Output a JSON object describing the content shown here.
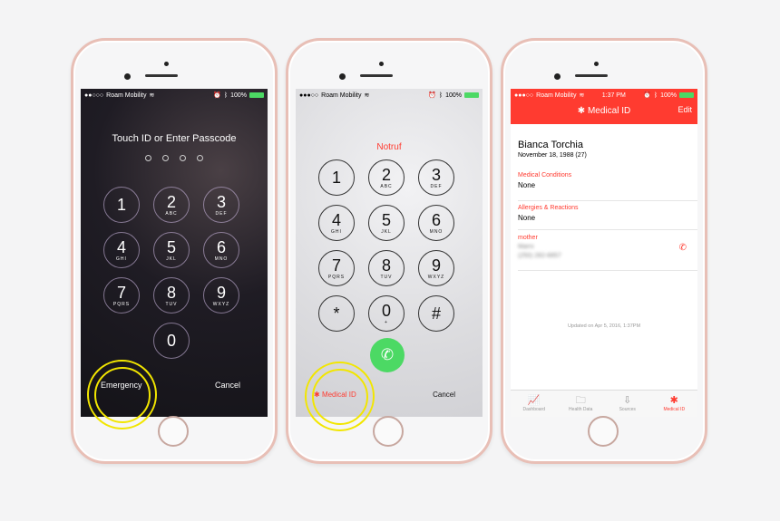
{
  "status": {
    "carrier": "Roam Mobility",
    "battery": "100%",
    "time": "1:37 PM"
  },
  "lock": {
    "title": "Touch ID or Enter Passcode",
    "keys": [
      {
        "n": "1",
        "a": ""
      },
      {
        "n": "2",
        "a": "ABC"
      },
      {
        "n": "3",
        "a": "DEF"
      },
      {
        "n": "4",
        "a": "GHI"
      },
      {
        "n": "5",
        "a": "JKL"
      },
      {
        "n": "6",
        "a": "MNO"
      },
      {
        "n": "7",
        "a": "PQRS"
      },
      {
        "n": "8",
        "a": "TUV"
      },
      {
        "n": "9",
        "a": "WXYZ"
      },
      {
        "n": "0",
        "a": ""
      }
    ],
    "emergency": "Emergency",
    "cancel": "Cancel"
  },
  "dialer": {
    "title": "Notruf",
    "keys": [
      {
        "n": "1",
        "a": ""
      },
      {
        "n": "2",
        "a": "ABC"
      },
      {
        "n": "3",
        "a": "DEF"
      },
      {
        "n": "4",
        "a": "GHI"
      },
      {
        "n": "5",
        "a": "JKL"
      },
      {
        "n": "6",
        "a": "MNO"
      },
      {
        "n": "7",
        "a": "PQRS"
      },
      {
        "n": "8",
        "a": "TUV"
      },
      {
        "n": "9",
        "a": "WXYZ"
      },
      {
        "n": "*",
        "a": ""
      },
      {
        "n": "0",
        "a": "+"
      },
      {
        "n": "#",
        "a": ""
      }
    ],
    "medical_id": "Medical ID",
    "cancel": "Cancel"
  },
  "medical": {
    "header": "Medical ID",
    "edit": "Edit",
    "name": "Bianca Torchia",
    "dob": "November 18, 1988 (27)",
    "conditions_label": "Medical Conditions",
    "conditions_value": "None",
    "allergies_label": "Allergies & Reactions",
    "allergies_value": "None",
    "contact_label": "mother",
    "contact_name": "Marni",
    "contact_phone": "(250) 282-8857",
    "updated": "Updated on Apr 5, 2016, 1:37PM",
    "tabs": [
      {
        "label": "Dashboard",
        "icon": "📈"
      },
      {
        "label": "Health Data",
        "icon": "🗀"
      },
      {
        "label": "Sources",
        "icon": "⇩"
      },
      {
        "label": "Medical ID",
        "icon": "✱"
      }
    ]
  },
  "colors": {
    "accent": "#ff3b30",
    "call": "#4cd964",
    "highlight": "#f2e600"
  }
}
